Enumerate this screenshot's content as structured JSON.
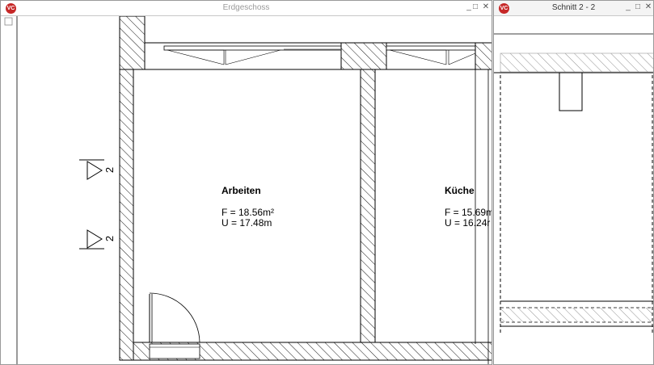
{
  "left_window": {
    "title": "Erdgeschoss",
    "logo_text": "VC",
    "minimize": "_",
    "maximize": "□",
    "close": "✕"
  },
  "right_window": {
    "title": "Schnitt 2 - 2",
    "logo_text": "VC",
    "minimize": "_",
    "maximize": "□",
    "close": "✕"
  },
  "rooms": [
    {
      "name": "Arbeiten",
      "area": "F = 18.56m²",
      "perimeter": "U = 17.48m"
    },
    {
      "name": "Küche",
      "area": "F = 15.69m",
      "perimeter": "U = 16.24r"
    }
  ],
  "section_markers": [
    "2",
    "2"
  ],
  "colors": {
    "accent": "#c62828",
    "hatch": "#000000",
    "background": "#ffffff"
  }
}
